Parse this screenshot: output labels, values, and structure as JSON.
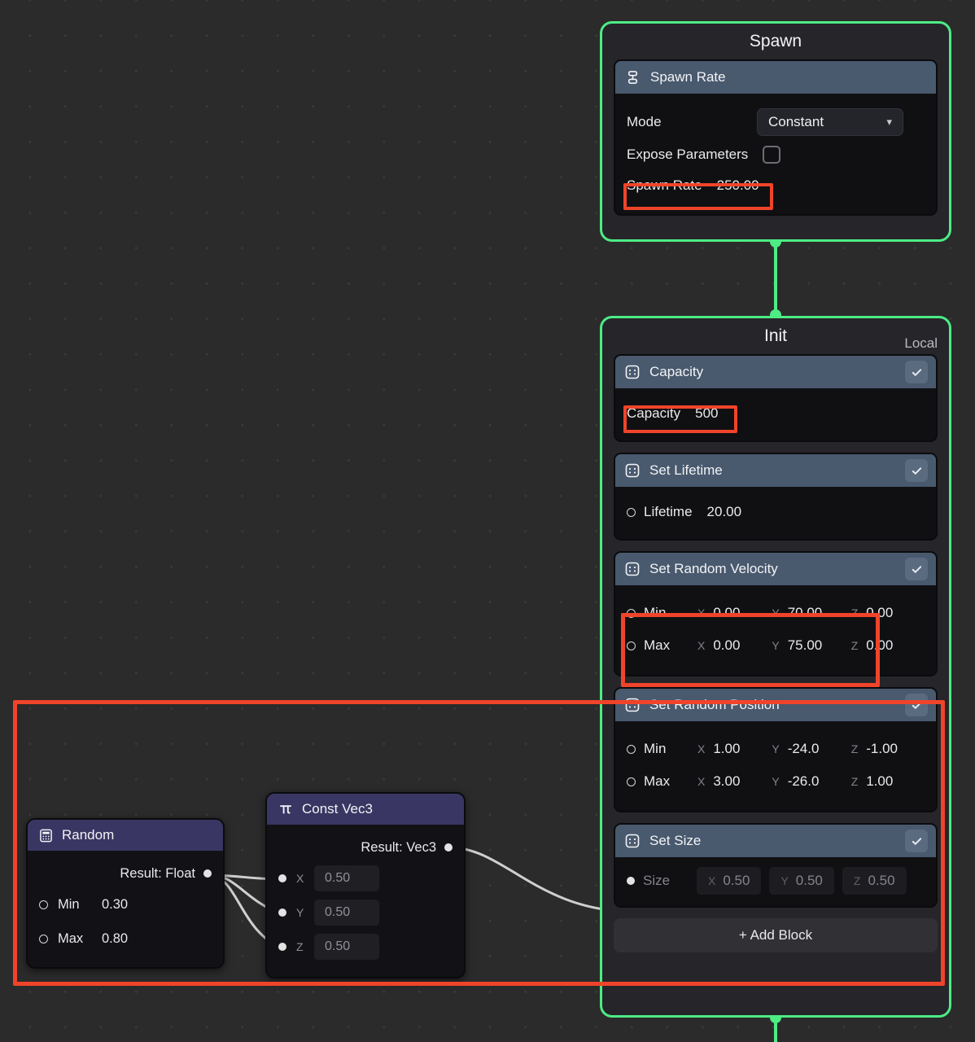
{
  "canvas": {
    "background_color": "#2b2b2b",
    "grid_dot_color": "#3a3a3a",
    "flow_color": "#4dec85",
    "wire_color": "#cfcfcf",
    "annotation_color": "#f0442a",
    "node_header_color": "#3a3663",
    "block_header_color": "#49596e"
  },
  "spawn_node": {
    "title": "Spawn",
    "blocks": [
      {
        "icon": "hierarchy-icon",
        "title": "Spawn Rate",
        "mode": {
          "label": "Mode",
          "value": "Constant",
          "chevron": "chevron-down-icon"
        },
        "expose": {
          "label": "Expose Parameters",
          "checked": false
        },
        "rate": {
          "label": "Spawn Rate",
          "value": "250.00"
        }
      }
    ]
  },
  "init_node": {
    "title": "Init",
    "space": "Local",
    "add_block_label": "+ Add Block",
    "blocks": [
      {
        "icon": "grid-dots-icon",
        "title": "Capacity",
        "enabled": true,
        "check_icon": "check-icon",
        "rows": [
          {
            "kind": "plain",
            "label": "Capacity",
            "value": "500"
          }
        ]
      },
      {
        "icon": "grid-dots-icon",
        "title": "Set Lifetime",
        "enabled": true,
        "check_icon": "check-icon",
        "rows": [
          {
            "kind": "port-scalar",
            "port": "hollow",
            "label": "Lifetime",
            "value": "20.00"
          }
        ]
      },
      {
        "icon": "grid-dots-icon",
        "title": "Set Random Velocity",
        "enabled": true,
        "check_icon": "check-icon",
        "rows": [
          {
            "kind": "port-vec3",
            "port": "hollow",
            "label": "Min",
            "x": "0.00",
            "y": "70.00",
            "z": "0.00"
          },
          {
            "kind": "port-vec3",
            "port": "hollow",
            "label": "Max",
            "x": "0.00",
            "y": "75.00",
            "z": "0.00"
          }
        ]
      },
      {
        "icon": "grid-dots-icon",
        "title": "Set Random Position",
        "enabled": true,
        "check_icon": "check-icon",
        "rows": [
          {
            "kind": "port-vec3",
            "port": "hollow",
            "label": "Min",
            "x": "1.00",
            "y": "-24.0",
            "z": "-1.00"
          },
          {
            "kind": "port-vec3",
            "port": "hollow",
            "label": "Max",
            "x": "3.00",
            "y": "-26.0",
            "z": "1.00"
          }
        ]
      },
      {
        "icon": "grid-dots-icon",
        "title": "Set Size",
        "enabled": true,
        "check_icon": "check-icon",
        "rows": [
          {
            "kind": "port-vec3-dim",
            "port": "filled",
            "label": "Size",
            "x": "0.50",
            "y": "0.50",
            "z": "0.50"
          }
        ]
      }
    ]
  },
  "random_node": {
    "icon": "calculator-icon",
    "title": "Random",
    "output": {
      "label": "Result: Float",
      "port": "filled"
    },
    "inputs": [
      {
        "label": "Min",
        "value": "0.30",
        "port": "hollow"
      },
      {
        "label": "Max",
        "value": "0.80",
        "port": "hollow"
      }
    ]
  },
  "const_vec3_node": {
    "icon": "pi-icon",
    "title": "Const Vec3",
    "output": {
      "label": "Result: Vec3",
      "port": "filled"
    },
    "inputs": [
      {
        "axis": "X",
        "value": "0.50",
        "port": "filled"
      },
      {
        "axis": "Y",
        "value": "0.50",
        "port": "filled"
      },
      {
        "axis": "Z",
        "value": "0.50",
        "port": "filled"
      }
    ]
  },
  "annotations": [
    {
      "name": "spawn-rate-highlight"
    },
    {
      "name": "capacity-highlight"
    },
    {
      "name": "random-velocity-highlight"
    },
    {
      "name": "graph-region-highlight"
    }
  ]
}
